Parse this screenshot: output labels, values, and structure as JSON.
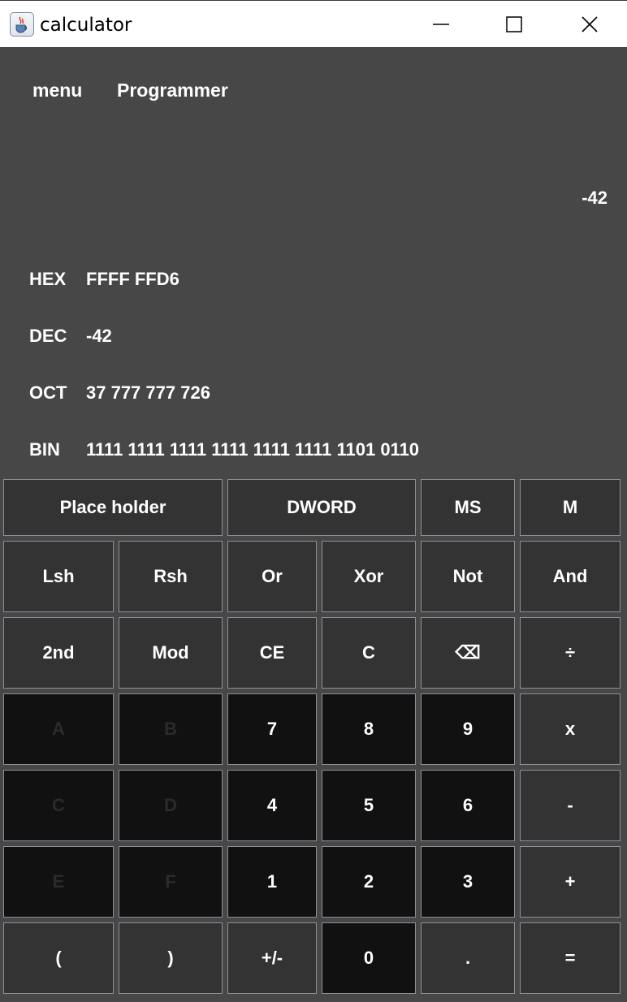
{
  "window": {
    "title": "calculator",
    "controls": {
      "minimize": "minimize-icon",
      "maximize": "maximize-icon",
      "close": "close-icon"
    }
  },
  "header": {
    "menu_label": "menu",
    "mode_label": "Programmer"
  },
  "display": {
    "value": "-42"
  },
  "radix": [
    {
      "name": "HEX",
      "value": "FFFF FFD6"
    },
    {
      "name": "DEC",
      "value": "-42"
    },
    {
      "name": "OCT",
      "value": "37 777 777 726"
    },
    {
      "name": "BIN",
      "value": "1111 1111 1111 1111 1111 1111 1101 0110"
    }
  ],
  "top_row": {
    "placeholder": "Place holder",
    "word_size": "DWORD",
    "memory_store": "MS",
    "memory": "M"
  },
  "keys": {
    "lsh": "Lsh",
    "rsh": "Rsh",
    "or": "Or",
    "xor": "Xor",
    "not": "Not",
    "and": "And",
    "second": "2nd",
    "mod": "Mod",
    "ce": "CE",
    "clear": "C",
    "backspace": "⌫",
    "divide": "÷",
    "a": "A",
    "b": "B",
    "seven": "7",
    "eight": "8",
    "nine": "9",
    "multiply": "x",
    "c_hex": "C",
    "d": "D",
    "four": "4",
    "five": "5",
    "six": "6",
    "minus": "-",
    "e": "E",
    "f": "F",
    "one": "1",
    "two": "2",
    "three": "3",
    "plus": "+",
    "lparen": "(",
    "rparen": ")",
    "negate": "+/-",
    "zero": "0",
    "decimal": ".",
    "equals": "="
  }
}
